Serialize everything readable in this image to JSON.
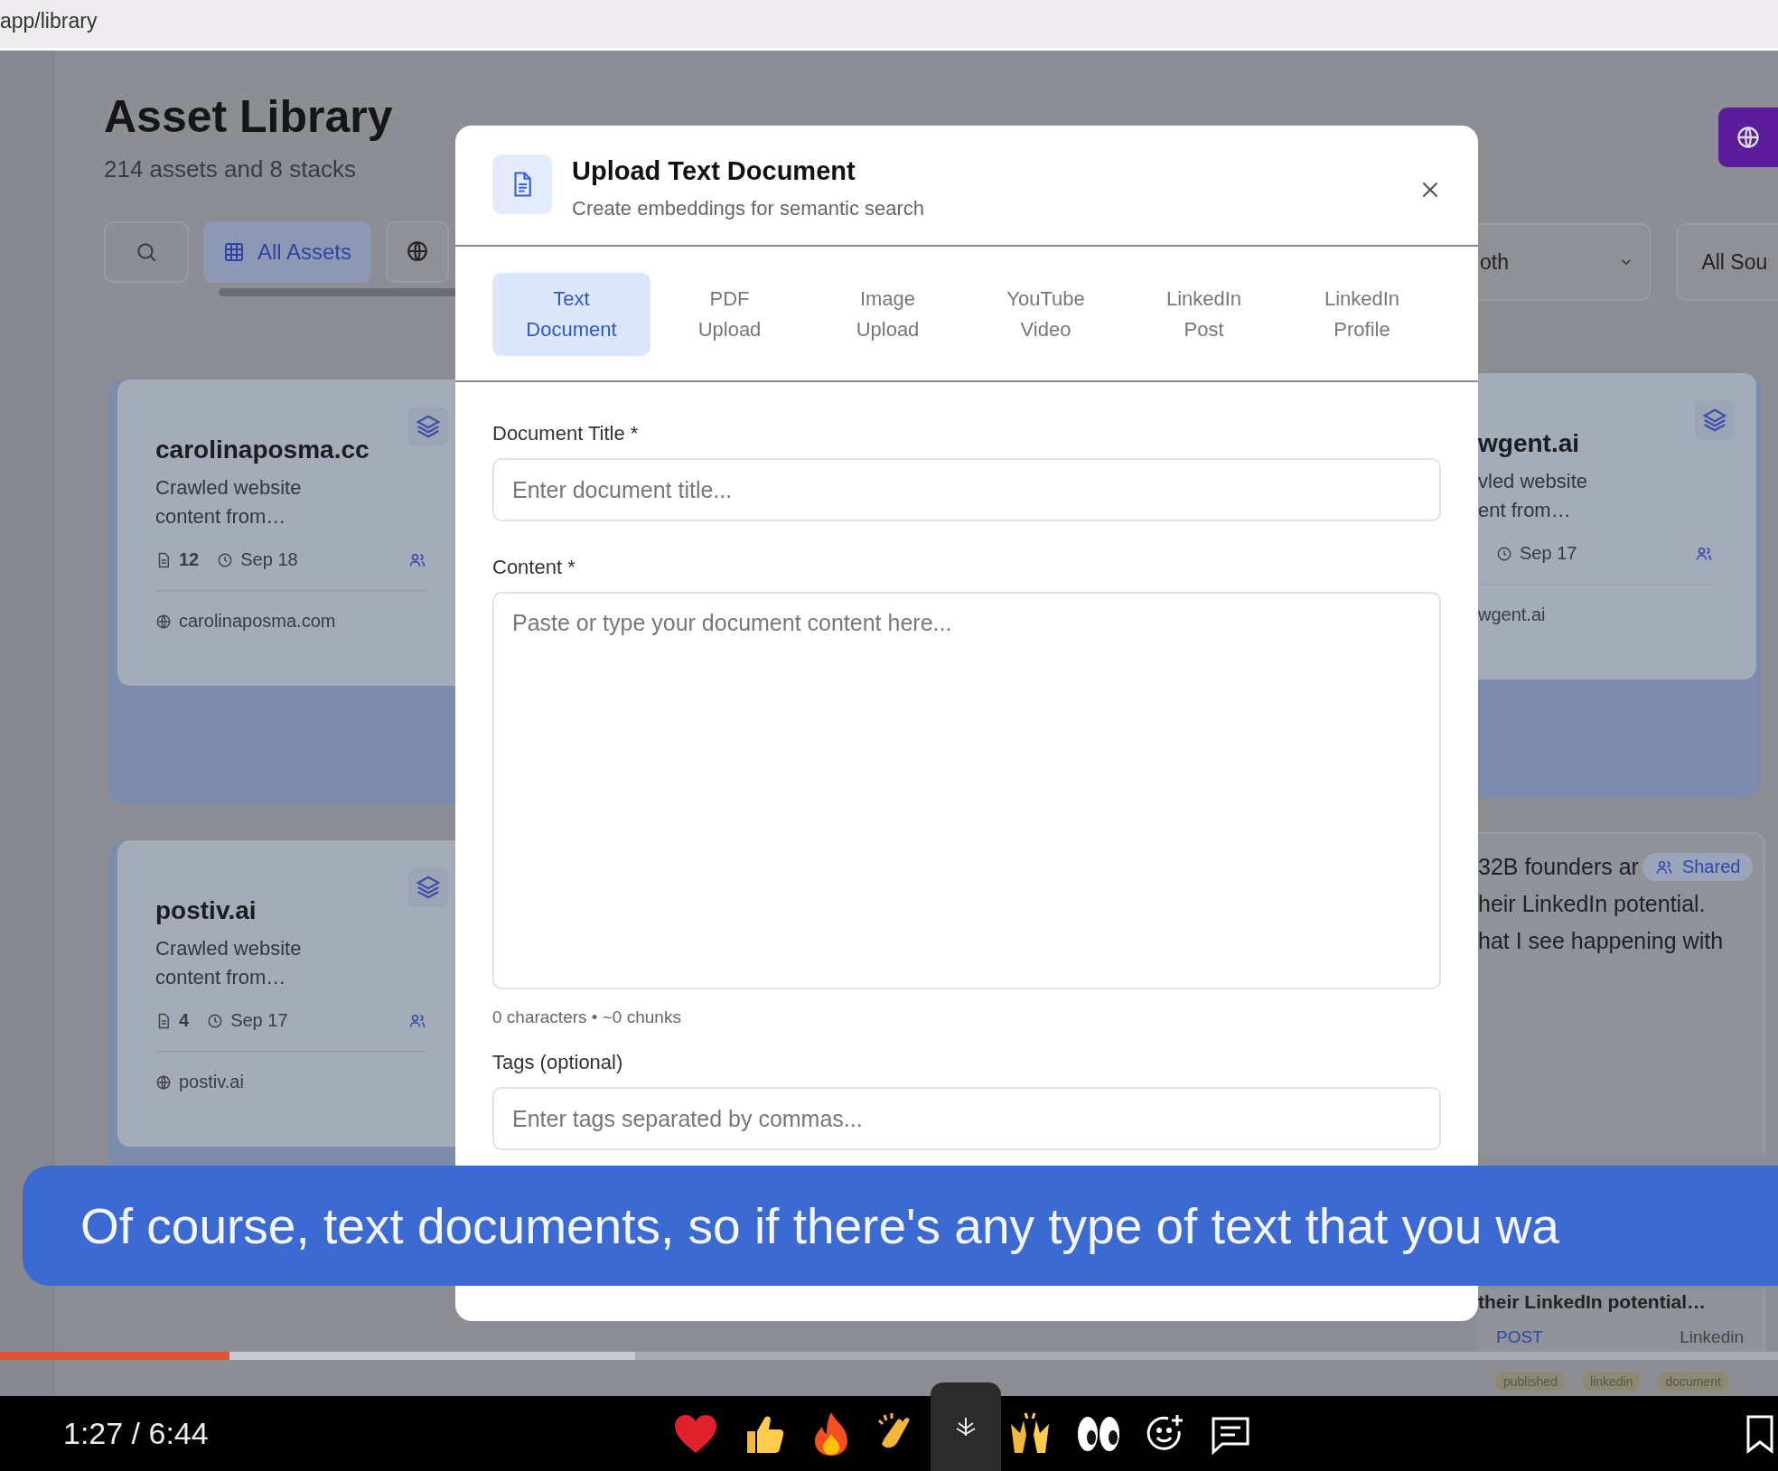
{
  "address_bar": {
    "url": "app/library"
  },
  "page": {
    "title": "Asset Library",
    "subtitle": "214 assets and 8 stacks",
    "filter_tabs": [
      {
        "label": "All Assets",
        "selected": true
      }
    ],
    "dropdowns": [
      {
        "value": "oth"
      },
      {
        "value": "All Sou"
      }
    ]
  },
  "left_cards": [
    {
      "title": "carolinaposma.cc",
      "description_lines": [
        "Crawled website",
        "content from…"
      ],
      "count": "12",
      "date": "Sep 18",
      "source": "carolinaposma.com"
    },
    {
      "title": "postiv.ai",
      "description_lines": [
        "Crawled website",
        "content from…"
      ],
      "count": "4",
      "date": "Sep 17",
      "source": "postiv.ai"
    }
  ],
  "right_card": {
    "title": "wgent.ai",
    "description_lines": [
      "vled website",
      "ent from…"
    ],
    "date": "Sep 17",
    "source": "wgent.ai"
  },
  "right_post": {
    "lines": [
      "32B founders ar",
      "heir LinkedIn potential.",
      "hat I see happening with"
    ],
    "badge": "Shared",
    "excerpt": "their LinkedIn potential…",
    "type": "POST",
    "platform": "Linkedin",
    "tags": [
      "published",
      "linkedin",
      "document"
    ]
  },
  "modal": {
    "title": "Upload Text Document",
    "subtitle": "Create embeddings for semantic search",
    "tabs": [
      {
        "label": "Text Document",
        "selected": true
      },
      {
        "label": "PDF Upload",
        "selected": false
      },
      {
        "label": "Image Upload",
        "selected": false
      },
      {
        "label": "YouTube Video",
        "selected": false
      },
      {
        "label": "LinkedIn Post",
        "selected": false
      },
      {
        "label": "LinkedIn Profile",
        "selected": false
      }
    ],
    "form": [
      {
        "kind": "input",
        "label": "Document Title *",
        "placeholder": "Enter document title..."
      },
      {
        "kind": "textarea",
        "label": "Content *",
        "placeholder": "Paste or type your document content here..."
      },
      {
        "kind": "hint",
        "text": "0 characters • ~0 chunks"
      },
      {
        "kind": "input",
        "label": "Tags (optional)",
        "placeholder": "Enter tags separated by commas..."
      }
    ]
  },
  "player": {
    "caption": "Of course, text documents, so if there's any type of text that you wa",
    "time": "1:27 / 6:44",
    "progress": {
      "level": 0.129
    },
    "buffer": {
      "level": 0.357
    }
  }
}
